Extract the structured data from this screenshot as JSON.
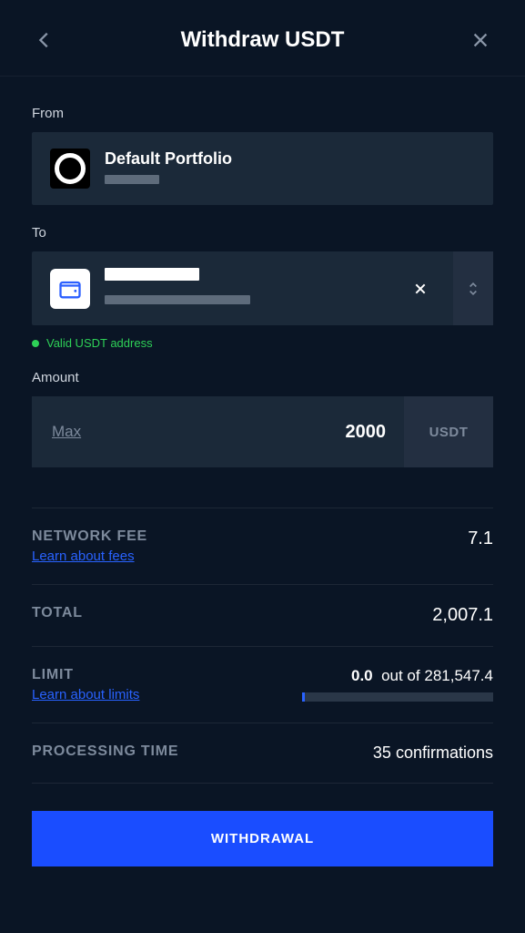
{
  "header": {
    "title": "Withdraw USDT"
  },
  "from": {
    "label": "From",
    "portfolio_name": "Default Portfolio"
  },
  "to": {
    "label": "To",
    "valid_msg": "Valid USDT address"
  },
  "amount": {
    "label": "Amount",
    "max_label": "Max",
    "value": "2000",
    "unit": "USDT"
  },
  "fee": {
    "label": "NETWORK FEE",
    "learn": "Learn about fees",
    "value": "7.1"
  },
  "total": {
    "label": "TOTAL",
    "value": "2,007.1"
  },
  "limit": {
    "label": "LIMIT",
    "learn": "Learn about limits",
    "used": "0.0",
    "joiner": "out of",
    "cap": "281,547.4"
  },
  "processing": {
    "label": "PROCESSING TIME",
    "value": "35 confirmations"
  },
  "cta": {
    "label": "WITHDRAWAL"
  }
}
